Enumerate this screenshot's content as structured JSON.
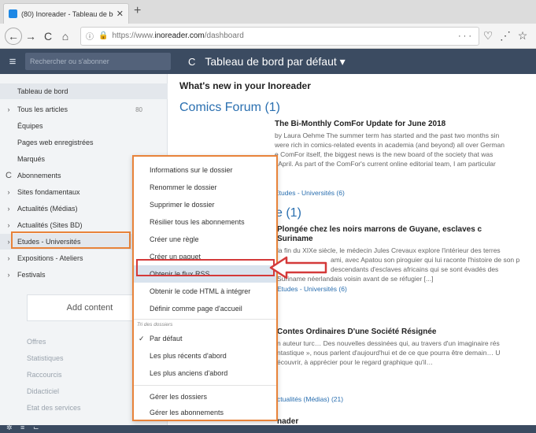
{
  "browser": {
    "tab_title": "(80) Inoreader - Tableau de bo",
    "url_prefix": "https://www.",
    "url_domain": "inoreader.com",
    "url_path": "/dashboard",
    "url_tail": "···"
  },
  "header": {
    "search_placeholder": "Rechercher ou s'abonner",
    "title": "Tableau de bord par défaut ▾"
  },
  "sidebar": {
    "items": [
      {
        "label": "Tableau de bord",
        "arrow": "",
        "count": ""
      },
      {
        "label": "Tous les articles",
        "arrow": "›",
        "count": "80"
      },
      {
        "label": "Équipes",
        "arrow": "",
        "count": ""
      },
      {
        "label": "Pages web enregistrées",
        "arrow": "",
        "count": ""
      },
      {
        "label": "Marqués",
        "arrow": "",
        "count": ""
      },
      {
        "label": "Abonnements",
        "arrow": "C",
        "count": ""
      },
      {
        "label": "Sites fondamentaux",
        "arrow": "›",
        "count": ""
      },
      {
        "label": "Actualités (Médias)",
        "arrow": "›",
        "count": ""
      },
      {
        "label": "Actualités (Sites BD)",
        "arrow": "›",
        "count": ""
      },
      {
        "label": "Etudes - Universités",
        "arrow": "›",
        "count": ""
      },
      {
        "label": "Expositions - Ateliers",
        "arrow": "›",
        "count": ""
      },
      {
        "label": "Festivals",
        "arrow": "›",
        "count": ""
      }
    ],
    "add_content": "Add content",
    "footer_items": [
      "Offres",
      "Statistiques",
      "Raccourcis",
      "Didacticiel",
      "Etat des services"
    ]
  },
  "main": {
    "whats_new": "What's new in your Inoreader",
    "section1": "Comics Forum (1)",
    "article1_title": "The Bi-Monthly ComFor Update for June 2018",
    "article1_lines": [
      "by Laura Oehme The summer term has started and the past two months sin",
      "were rich in comics-related events in academia (and beyond) all over German",
      "e ComFor itself, the biggest news is the new board of the society that was",
      "f April. As part of the ComFor's current online editorial team, I am particular"
    ],
    "article1_folder": "Etudes - Universités (6)",
    "section2": "e (1)",
    "article2_title": "Plongée chez les noirs marrons de Guyane, esclaves c",
    "article2_subtitle": "Suriname",
    "article2_lines": [
      "la fin du XIXe siècle, le médecin Jules Crevaux explore l'intérieur des terres",
      "ami, avec Apatou son piroguier qui lui raconte l'histoire de son p",
      "descendants d'esclaves africains qui se sont évadés des",
      "Suriname néerlandais voisin avant de se réfugier [...]"
    ],
    "article2_folder": "Etudes - Universités (6)",
    "article3_title": "Contes Ordinaires D'une Société Résignée",
    "article3_lines": [
      "n auteur turc… Des nouvelles dessinées qui, au travers d'un imaginaire rés",
      "ntastique », nous parlent d'aujourd'hui et de ce que pourra être demain… U",
      "écouvrir, à apprécier pour le regard graphique qu'il…"
    ],
    "article3_folder": "ctualités (Médias) (21)",
    "bottom_partial": "nader"
  },
  "menu": {
    "items": [
      "Informations sur le dossier",
      "Renommer le dossier",
      "Supprimer le dossier",
      "Résilier tous les abonnements",
      "Créer une règle",
      "Créer un paquet",
      "Obtenir le flux RSS",
      "Obtenir le code HTML à intégrer",
      "Définir comme page d'accueil"
    ],
    "sort_label": "Tri des dossiers",
    "sort_items": [
      {
        "label": "Par défaut",
        "checked": "✓"
      },
      {
        "label": "Les plus récents d'abord",
        "checked": ""
      },
      {
        "label": "Les plus anciens d'abord",
        "checked": ""
      }
    ],
    "manage_items": [
      "Gérer les dossiers",
      "Gérer les abonnements"
    ]
  },
  "colors": {
    "header_bg": "#3b4b61",
    "accent_orange": "#e8833a",
    "accent_red": "#d43a3a",
    "link_blue": "#2a6fb0"
  },
  "icons": {
    "favicon": "inoreader-favicon",
    "back": "arrow-left-icon",
    "forward": "arrow-right-icon",
    "reload": "reload-icon",
    "home": "home-icon",
    "menu": "hamburger-icon",
    "refresh": "refresh-icon"
  }
}
